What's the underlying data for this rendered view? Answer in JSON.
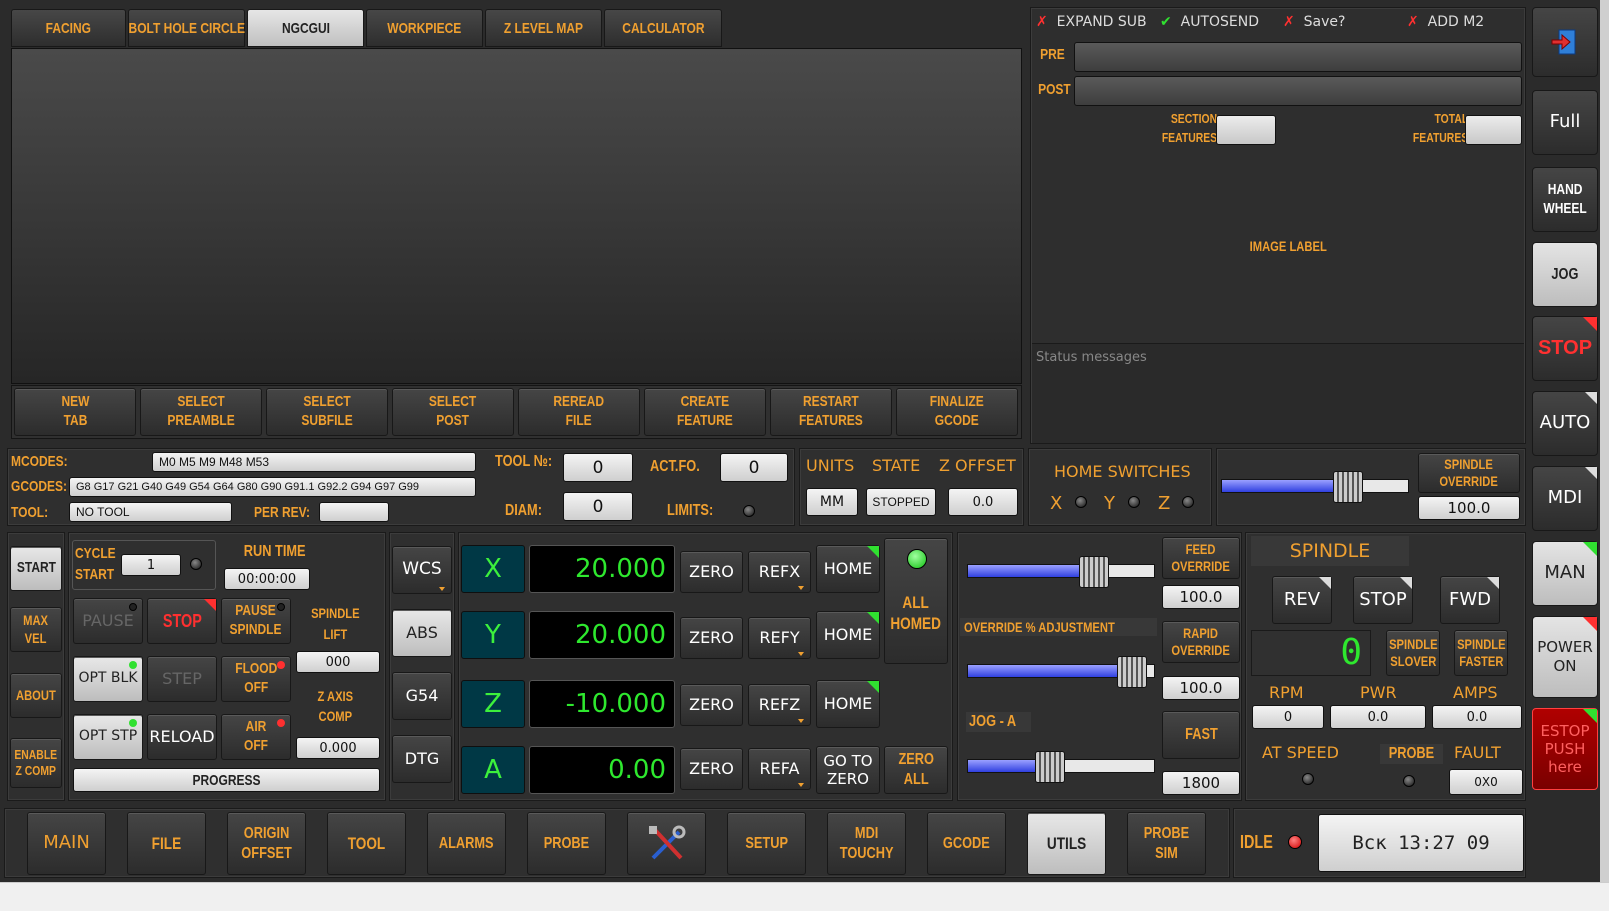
{
  "tabs": [
    {
      "label": "FACING"
    },
    {
      "label": "BOLT HOLE CIRCLE"
    },
    {
      "label": "NGCGUI"
    },
    {
      "label": "WORKPIECE"
    },
    {
      "label": "Z LEVEL MAP"
    },
    {
      "label": "CALCULATOR"
    }
  ],
  "ngc_buttons": [
    {
      "l1": "NEW",
      "l2": "TAB"
    },
    {
      "l1": "SELECT",
      "l2": "PREAMBLE"
    },
    {
      "l1": "SELECT",
      "l2": "SUBFILE"
    },
    {
      "l1": "SELECT",
      "l2": "POST"
    },
    {
      "l1": "REREAD",
      "l2": "FILE"
    },
    {
      "l1": "CREATE",
      "l2": "FEATURE"
    },
    {
      "l1": "RESTART",
      "l2": "FEATURES"
    },
    {
      "l1": "FINALIZE",
      "l2": "GCODE"
    }
  ],
  "options": {
    "expand_sub": "EXPAND SUB",
    "autosend": "AUTOSEND",
    "save": "Save?",
    "add_m2": "ADD M2"
  },
  "pre_label": "PRE",
  "post_label": "POST",
  "section_features": {
    "l1": "SECTION",
    "l2": "FEATURES"
  },
  "total_features": {
    "l1": "TOTAL",
    "l2": "FEATURES"
  },
  "image_label": "IMAGE LABEL",
  "status_placeholder": "Status messages",
  "right_bar": {
    "full": "Full",
    "hand1": "HAND",
    "hand2": "WHEEL",
    "jog": "JOG",
    "stop": "STOP",
    "auto": "AUTO",
    "mdi": "MDI",
    "man": "MAN",
    "power1": "POWER",
    "power2": "ON",
    "estop1": "ESTOP",
    "estop2": "PUSH",
    "estop3": "here"
  },
  "info": {
    "mcodes_label": "MCODES:",
    "mcodes": "M0 M5 M9 M48 M53",
    "gcodes_label": "GCODES:",
    "gcodes": "G8 G17 G21 G40 G49 G54 G64 G80 G90 G91.1 G92.2 G94 G97 G99",
    "tool_label": "TOOL:",
    "tool": "NO TOOL",
    "per_rev_label": "PER REV:",
    "tool_no_label": "TOOL №:",
    "tool_no": "0",
    "act_fo_label": "ACT.FO.",
    "act_fo": "0",
    "diam_label": "DIAM:",
    "diam": "0",
    "limits_label": "LIMITS:"
  },
  "units": {
    "units_label": "UNITS",
    "state_label": "STATE",
    "zoffset_label": "Z OFFSET",
    "units": "MM",
    "state": "STOPPED",
    "zoffset": "0.0"
  },
  "home_switches": {
    "title": "HOME SWITCHES",
    "x": "X",
    "y": "Y",
    "z": "Z"
  },
  "spindle_override": {
    "l1": "SPINDLE",
    "l2": "OVERRIDE",
    "value": "100.0",
    "level": 0.68
  },
  "left_col": {
    "start": "START",
    "max1": "MAX",
    "max2": "VEL",
    "about": "ABOUT",
    "enable1": "ENABLE",
    "enable2": "Z COMP"
  },
  "cycle": {
    "cycle1": "CYCLE",
    "cycle2": "START",
    "line": "1",
    "run_time_label": "RUN TIME",
    "run_time": "00:00:00",
    "pause": "PAUSE",
    "stop": "STOP",
    "pause_spindle1": "PAUSE",
    "pause_spindle2": "SPINDLE",
    "spindle_lift1": "SPINDLE",
    "spindle_lift2": "LIFT",
    "lift_value": "000",
    "opt_blk": "OPT BLK",
    "step": "STEP",
    "flood1": "FLOOD",
    "flood2": "OFF",
    "zaxis1": "Z AXIS",
    "zaxis2": "COMP",
    "zcomp_value": "0.000",
    "opt_stp": "OPT STP",
    "reload": "RELOAD",
    "air1": "AIR",
    "air2": "OFF",
    "progress": "PROGRESS"
  },
  "coord_buttons": {
    "wcs": "WCS",
    "abs": "ABS",
    "g54": "G54",
    "dtg": "DTG"
  },
  "axes": [
    {
      "axis": "X",
      "value": "20.000",
      "zero": "ZERO",
      "ref": "REFX",
      "home": "HOME"
    },
    {
      "axis": "Y",
      "value": "20.000",
      "zero": "ZERO",
      "ref": "REFY",
      "home": "HOME"
    },
    {
      "axis": "Z",
      "value": "-10.000",
      "zero": "ZERO",
      "ref": "REFZ",
      "home": "HOME"
    },
    {
      "axis": "A",
      "value": "0.00",
      "zero": "ZERO",
      "ref": "REFA",
      "home1": "GO TO",
      "home2": "ZERO"
    }
  ],
  "all_homed": {
    "l1": "ALL",
    "l2": "HOMED"
  },
  "zero_all": {
    "l1": "ZERO",
    "l2": "ALL"
  },
  "overrides": {
    "feed1": "FEED",
    "feed2": "OVERRIDE",
    "feed_value": "100.0",
    "feed_level": 0.68,
    "override_adj": "OVERRIDE % ADJUSTMENT",
    "rapid1": "RAPID",
    "rapid2": "OVERRIDE",
    "rapid_value": "100.0",
    "rapid_level": 0.88,
    "jog_label": "JOG - A",
    "fast": "FAST",
    "jog_value": "1800",
    "jog_level": 0.44
  },
  "spindle": {
    "title": "SPINDLE",
    "rev": "REV",
    "stop": "STOP",
    "fwd": "FWD",
    "speed": "0",
    "slower1": "SPINDLE",
    "slower2": "SLOVER",
    "faster1": "SPINDLE",
    "faster2": "FASTER",
    "rpm_label": "RPM",
    "rpm": "0",
    "pwr_label": "PWR",
    "pwr": "0.0",
    "amps_label": "AMPS",
    "amps": "0.0",
    "at_speed_label": "AT SPEED",
    "probe_label": "PROBE",
    "fault_label": "FAULT",
    "fault": "0X0"
  },
  "bottom_tabs": [
    {
      "label": "MAIN"
    },
    {
      "label": "FILE"
    },
    {
      "l1": "ORIGIN",
      "l2": "OFFSET"
    },
    {
      "label": "TOOL"
    },
    {
      "label": "ALARMS"
    },
    {
      "label": "PROBE"
    },
    {
      "icon": "tools-icon"
    },
    {
      "label": "SETUP"
    },
    {
      "l1": "MDI",
      "l2": "TOUCHY"
    },
    {
      "label": "GCODE"
    },
    {
      "label": "UTILS"
    },
    {
      "l1": "PROBE",
      "l2": "SIM"
    }
  ],
  "status_bar": {
    "idle": "IDLE",
    "clock": "Вск 13:27 09"
  }
}
